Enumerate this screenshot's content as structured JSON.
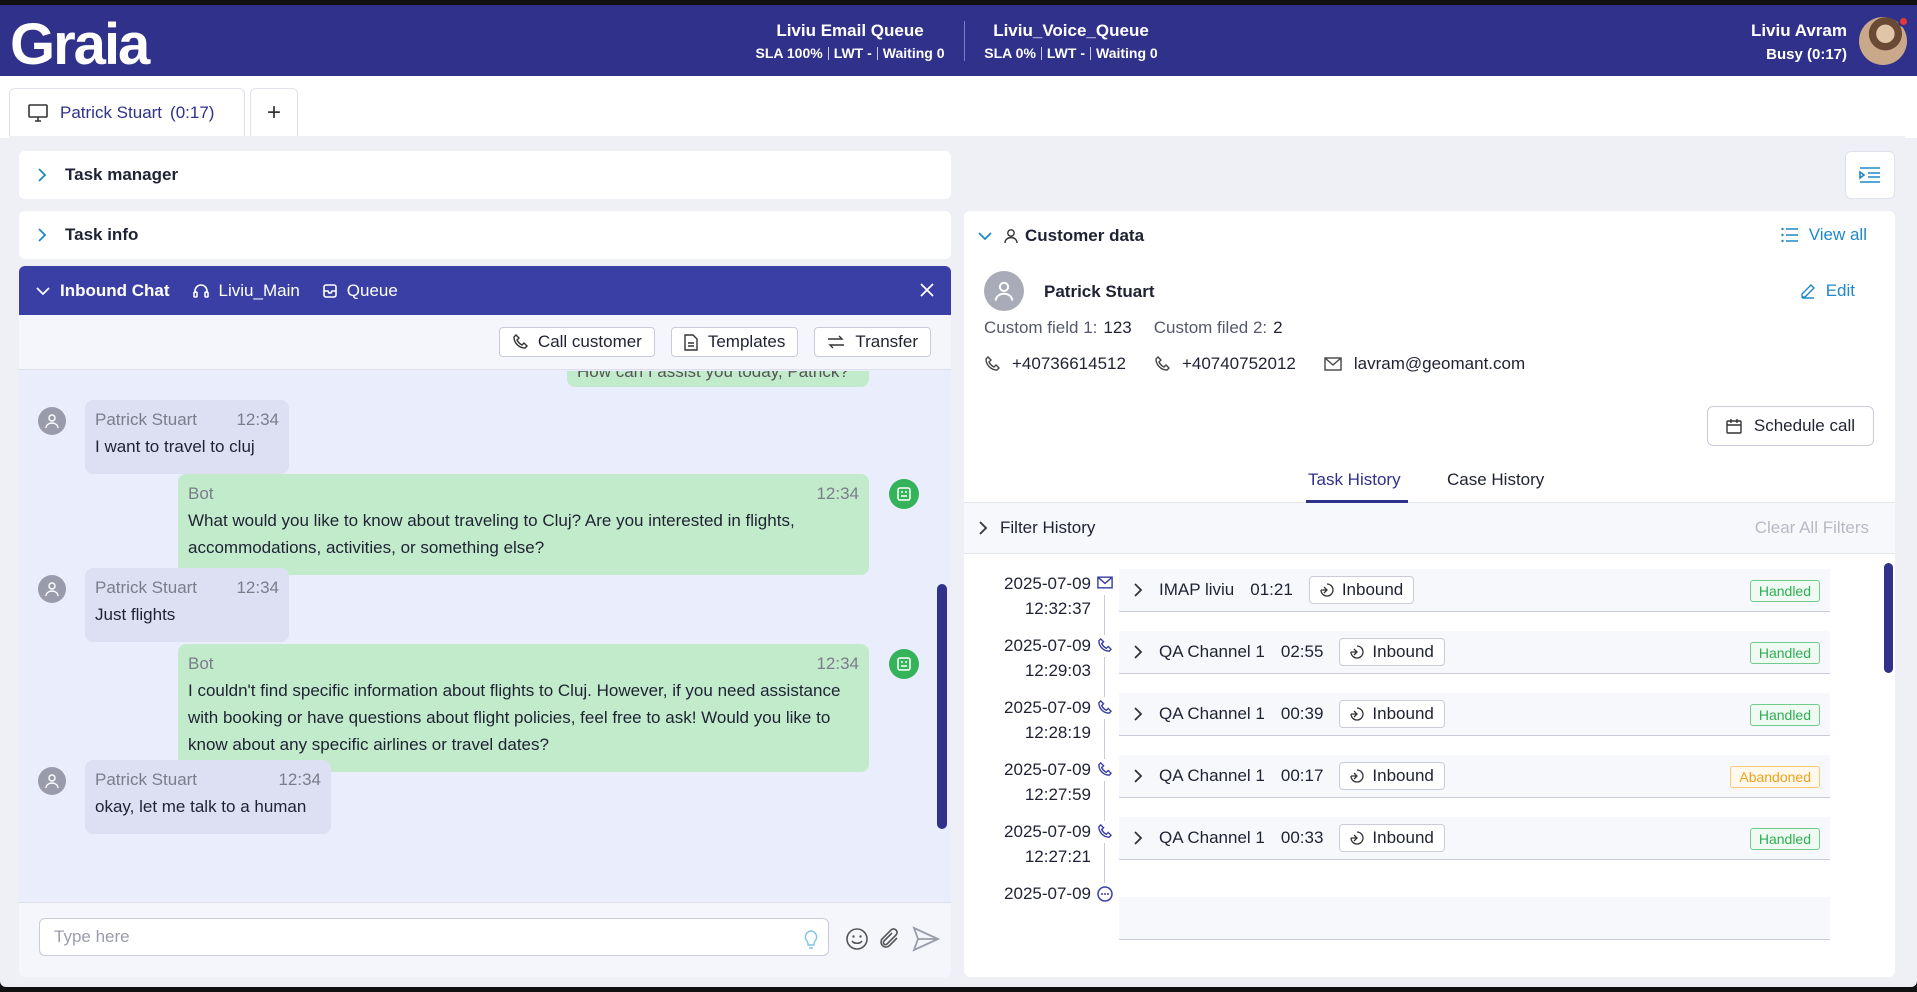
{
  "app": {
    "logo": "Graia"
  },
  "queues": [
    {
      "name": "Liviu Email Queue",
      "sla": "SLA 100%",
      "lwt": "LWT -",
      "waiting": "Waiting 0"
    },
    {
      "name": "Liviu_Voice_Queue",
      "sla": "SLA 0%",
      "lwt": "LWT -",
      "waiting": "Waiting 0"
    }
  ],
  "user": {
    "name": "Liviu Avram",
    "status": "Busy (0:17)"
  },
  "session_tab": {
    "name": "Patrick Stuart",
    "time": "(0:17)",
    "add": "+"
  },
  "sections": {
    "task_manager": "Task manager",
    "task_info": "Task info"
  },
  "chat": {
    "type": "Inbound Chat",
    "agent": "Liviu_Main",
    "queue": "Queue",
    "actions": {
      "call": "Call customer",
      "templates": "Templates",
      "transfer": "Transfer"
    },
    "messages": [
      {
        "sender": "Bot",
        "time": "",
        "text": "How can I assist you today, Patrick?"
      },
      {
        "sender": "Patrick Stuart",
        "time": "12:34",
        "text": "I want to travel to cluj"
      },
      {
        "sender": "Bot",
        "time": "12:34",
        "text": "What would you like to know about traveling to Cluj? Are you interested in flights, accommodations, activities, or something else?"
      },
      {
        "sender": "Patrick Stuart",
        "time": "12:34",
        "text": "Just flights"
      },
      {
        "sender": "Bot",
        "time": "12:34",
        "text": "I couldn't find specific information about flights to Cluj. However, if you need assistance with booking or have questions about flight policies, feel free to ask! Would you like to know about any specific airlines or travel dates?"
      },
      {
        "sender": "Patrick Stuart",
        "time": "12:34",
        "text": "okay, let me talk to a human"
      }
    ],
    "composer_placeholder": "Type here"
  },
  "customer": {
    "header": "Customer data",
    "view_all": "View all",
    "name": "Patrick Stuart",
    "edit": "Edit",
    "field1_label": "Custom field 1:",
    "field1_value": "123",
    "field2_label": "Custom filed 2:",
    "field2_value": "2",
    "phone1": "+40736614512",
    "phone2": "+40740752012",
    "email": "lavram@geomant.com",
    "schedule": "Schedule call"
  },
  "history": {
    "tabs": {
      "task": "Task History",
      "case": "Case History"
    },
    "filter": "Filter History",
    "clear": "Clear All Filters",
    "rows": [
      {
        "date": "2025-07-09",
        "time": "12:32:37",
        "channel": "IMAP liviu",
        "duration": "01:21",
        "direction": "Inbound",
        "status": "Handled",
        "kind": "email"
      },
      {
        "date": "2025-07-09",
        "time": "12:29:03",
        "channel": "QA Channel 1",
        "duration": "02:55",
        "direction": "Inbound",
        "status": "Handled",
        "kind": "phone"
      },
      {
        "date": "2025-07-09",
        "time": "12:28:19",
        "channel": "QA Channel 1",
        "duration": "00:39",
        "direction": "Inbound",
        "status": "Handled",
        "kind": "phone"
      },
      {
        "date": "2025-07-09",
        "time": "12:27:59",
        "channel": "QA Channel 1",
        "duration": "00:17",
        "direction": "Inbound",
        "status": "Abandoned",
        "kind": "phone"
      },
      {
        "date": "2025-07-09",
        "time": "12:27:21",
        "channel": "QA Channel 1",
        "duration": "00:33",
        "direction": "Inbound",
        "status": "Handled",
        "kind": "phone"
      },
      {
        "date": "2025-07-09",
        "time": "",
        "channel": "",
        "duration": "",
        "direction": "",
        "status": "",
        "kind": "chat"
      }
    ]
  },
  "colors": {
    "brand": "#2f318b",
    "chat_header": "#3a3fa5",
    "bot_bubble": "#c2ebcc",
    "link": "#1e88c8",
    "handled": "#2fae54",
    "abandoned": "#f0a11b"
  }
}
